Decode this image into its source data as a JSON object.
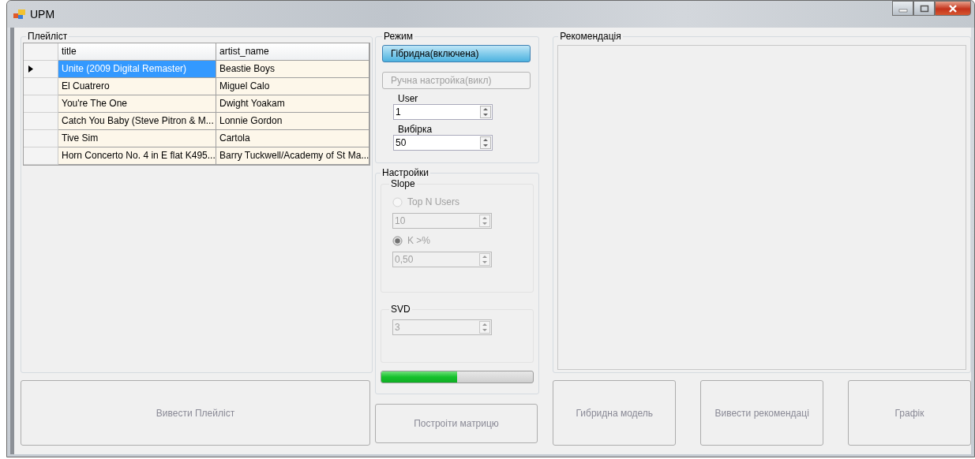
{
  "window": {
    "title": "UPM"
  },
  "playlist": {
    "title": "Плейліст",
    "columns": [
      "title",
      "artist_name"
    ],
    "rows": [
      {
        "cells": [
          "Unite (2009 Digital Remaster)",
          "Beastie Boys"
        ],
        "selected": true
      },
      {
        "cells": [
          "El Cuatrero",
          "Miguel Calo"
        ],
        "selected": false
      },
      {
        "cells": [
          "You're The One",
          "Dwight Yoakam"
        ],
        "selected": false
      },
      {
        "cells": [
          "Catch You Baby (Steve Pitron & M...",
          "Lonnie Gordon"
        ],
        "selected": false
      },
      {
        "cells": [
          "Tive Sim",
          "Cartola"
        ],
        "selected": false
      },
      {
        "cells": [
          "Horn Concerto No. 4 in E flat K495...",
          "Barry Tuckwell/Academy of St Ma..."
        ],
        "selected": false
      }
    ],
    "button": "Вивести Плейліст"
  },
  "mode": {
    "title": "Режим",
    "buttons": [
      {
        "label": "Гібридна(включена)",
        "on": true
      },
      {
        "label": "Ручна  настройка(викл)",
        "on": false
      }
    ],
    "fields": [
      {
        "label": "User",
        "value": "1"
      },
      {
        "label": "Вибірка",
        "value": "50"
      }
    ]
  },
  "settings": {
    "title": "Настройки",
    "disabled": true,
    "slope": {
      "title": "Slope",
      "options": [
        {
          "label": "Top N Users",
          "selected": false,
          "value": "10"
        },
        {
          "label": "K >%",
          "selected": true,
          "value": "0,50"
        }
      ]
    },
    "svd": {
      "title": "SVD",
      "value": "3"
    }
  },
  "progress": {
    "level": 0.5
  },
  "build_button": "Построiти матрицю",
  "recommendation": {
    "title": "Рекомендація"
  },
  "buttons": [
    "Гибридна модель",
    "Вивести рекомендаці",
    "Графік"
  ]
}
